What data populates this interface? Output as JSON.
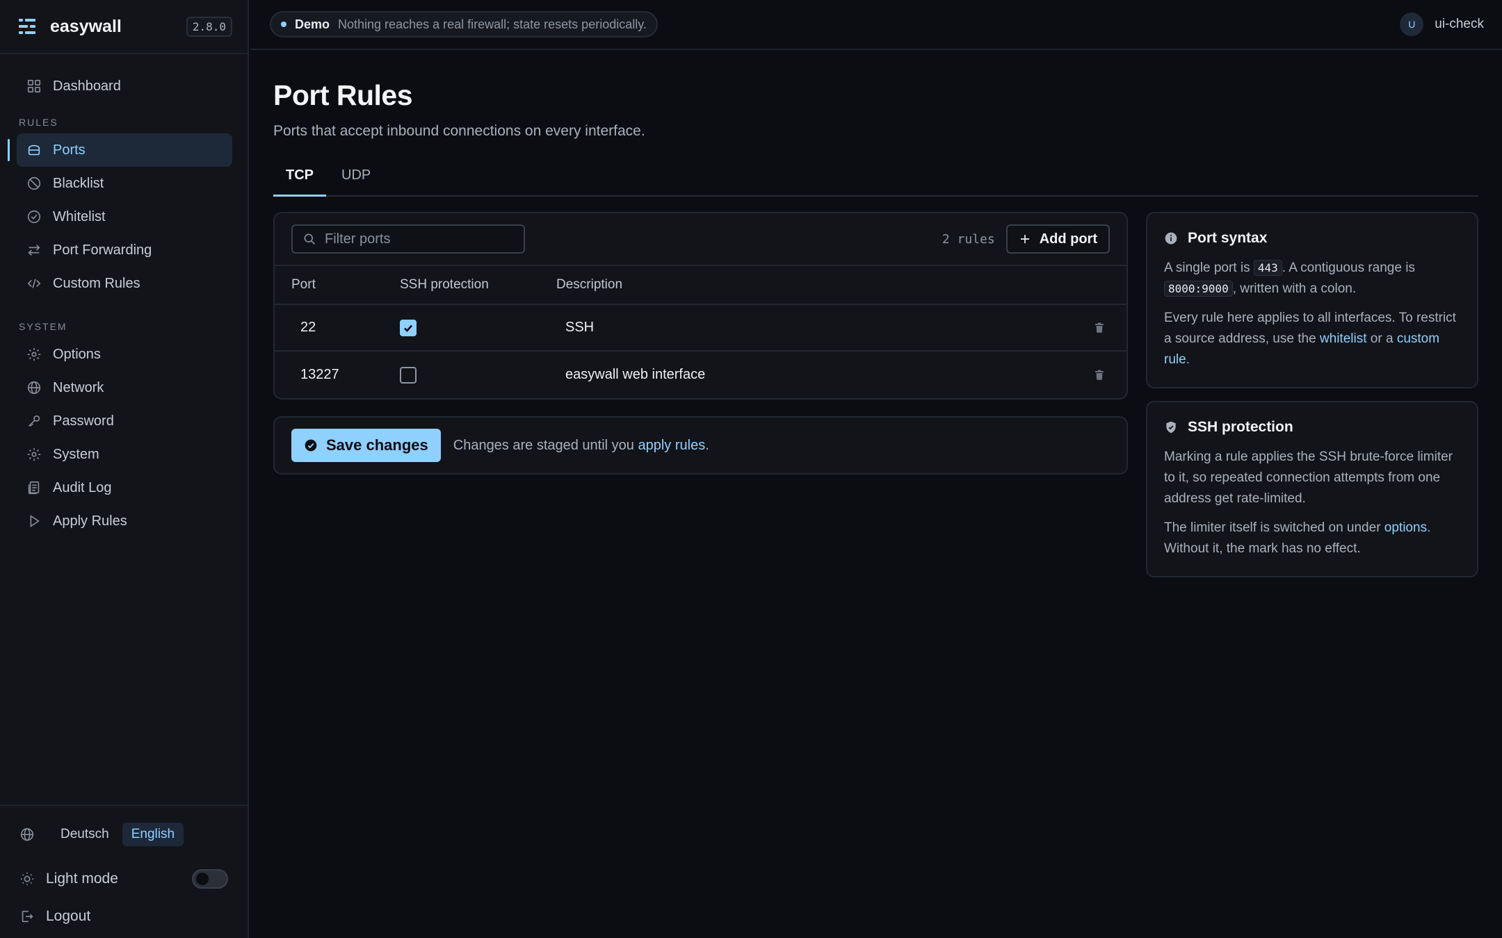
{
  "app": {
    "name": "easywall",
    "version": "2.8.0"
  },
  "topbar": {
    "demo_label": "Demo",
    "demo_text": "Nothing reaches a real firewall; state resets periodically.",
    "user_initial": "U",
    "username": "ui-check"
  },
  "sidebar": {
    "dashboard": "Dashboard",
    "rules_section": "RULES",
    "rules_items": [
      {
        "label": "Ports",
        "icon": "ports-icon",
        "active": true
      },
      {
        "label": "Blacklist",
        "icon": "ban-icon"
      },
      {
        "label": "Whitelist",
        "icon": "check-circle-icon"
      },
      {
        "label": "Port Forwarding",
        "icon": "arrows-icon"
      },
      {
        "label": "Custom Rules",
        "icon": "code-icon"
      }
    ],
    "system_section": "SYSTEM",
    "system_items": [
      {
        "label": "Options",
        "icon": "gear-icon"
      },
      {
        "label": "Network",
        "icon": "globe-icon"
      },
      {
        "label": "Password",
        "icon": "key-icon"
      },
      {
        "label": "System",
        "icon": "gear-icon"
      },
      {
        "label": "Audit Log",
        "icon": "log-icon"
      },
      {
        "label": "Apply Rules",
        "icon": "play-icon"
      }
    ],
    "languages": [
      "Deutsch",
      "English"
    ],
    "active_language": "English",
    "light_mode_label": "Light mode",
    "light_mode_on": false,
    "logout_label": "Logout"
  },
  "page": {
    "title": "Port Rules",
    "subtitle": "Ports that accept inbound connections on every interface.",
    "tabs": [
      "TCP",
      "UDP"
    ],
    "active_tab": "TCP"
  },
  "table": {
    "filter_placeholder": "Filter ports",
    "rule_count": "2 rules",
    "add_button": "Add port",
    "columns": [
      "Port",
      "SSH protection",
      "Description"
    ],
    "rows": [
      {
        "port": "22",
        "ssh": true,
        "description": "SSH"
      },
      {
        "port": "13227",
        "ssh": false,
        "description": "easywall web interface"
      }
    ]
  },
  "save": {
    "button": "Save changes",
    "note_before": "Changes are staged until you ",
    "note_link": "apply rules",
    "note_after": "."
  },
  "help": {
    "syntax": {
      "title": "Port syntax",
      "p1_a": "A single port is ",
      "p1_code1": "443",
      "p1_b": ". A contiguous range is ",
      "p1_code2": "8000:9000",
      "p1_c": ", written with a colon.",
      "p2_a": "Every rule here applies to all interfaces. To restrict a source address, use the ",
      "p2_link1": "whitelist",
      "p2_b": " or a ",
      "p2_link2": "custom rule",
      "p2_c": "."
    },
    "ssh": {
      "title": "SSH protection",
      "p1": "Marking a rule applies the SSH brute-force limiter to it, so repeated connection attempts from one address get rate-limited.",
      "p2_a": "The limiter itself is switched on under ",
      "p2_link": "options",
      "p2_b": ". Without it, the mark has no effect."
    }
  },
  "colors": {
    "accent": "#8fd0ff",
    "background": "#0b0d12",
    "panel": "#121419"
  }
}
